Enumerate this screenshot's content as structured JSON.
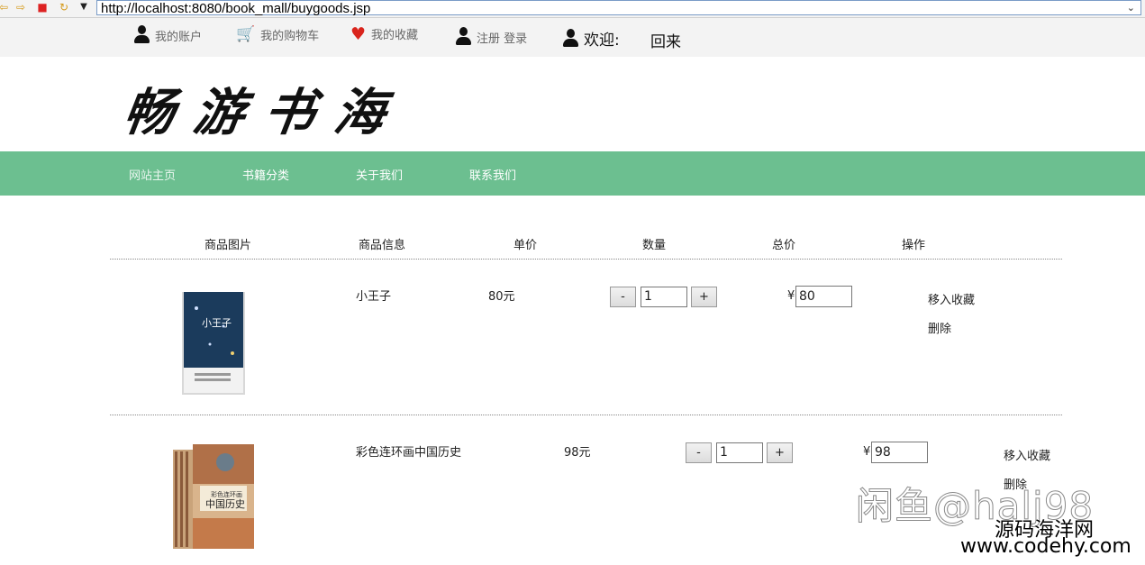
{
  "browser": {
    "url": "http://localhost:8080/book_mall/buygoods.jsp"
  },
  "topbar": {
    "account": "我的账户",
    "cart": "我的购物车",
    "favorites": "我的收藏",
    "register_login": "注册 登录",
    "welcome": "欢迎:",
    "username": "回来"
  },
  "logo": {
    "text": "畅游书海"
  },
  "nav": {
    "items": [
      "网站主页",
      "书籍分类",
      "关于我们",
      "联系我们"
    ]
  },
  "table": {
    "headers": [
      "商品图片",
      "商品信息",
      "单价",
      "数量",
      "总价",
      "操作"
    ],
    "rows": [
      {
        "name": "小王子",
        "unit_price": "80元",
        "qty_minus": "-",
        "quantity": "1",
        "qty_plus": "+",
        "currency": "¥",
        "total": "80",
        "action_favorite": "移入收藏",
        "action_delete": "删除"
      },
      {
        "name": "彩色连环画中国历史",
        "unit_price": "98元",
        "qty_minus": "-",
        "quantity": "1",
        "qty_plus": "+",
        "currency": "¥",
        "total": "98",
        "action_favorite": "移入收藏",
        "action_delete": "删除",
        "cover_title": "中国历史",
        "cover_subtitle": "彩色连环画"
      }
    ]
  },
  "watermark": {
    "line1": "闲鱼@halj98",
    "line2": "源码海洋网",
    "line3": "www.codehy.com"
  },
  "colors": {
    "nav_bg": "#6cbf90",
    "topbar_bg": "#f3f3f3",
    "heart": "#d9241c"
  }
}
